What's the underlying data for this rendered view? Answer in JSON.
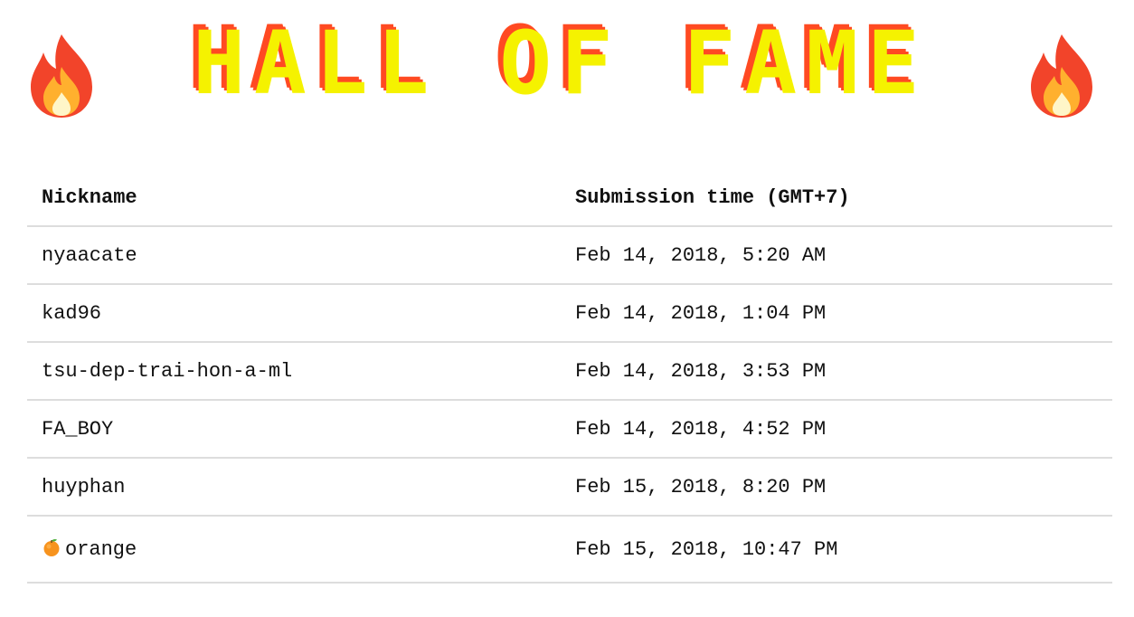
{
  "header": {
    "title": "HALL OF FAME",
    "left_icon": "fire-icon",
    "right_icon": "fire-icon"
  },
  "table": {
    "columns": [
      "Nickname",
      "Submission time (GMT+7)"
    ],
    "rows": [
      {
        "nickname": "nyaacate",
        "time": "Feb 14, 2018, 5:20 AM"
      },
      {
        "nickname": "kad96",
        "time": "Feb 14, 2018, 1:04 PM"
      },
      {
        "nickname": "tsu-dep-trai-hon-a-ml",
        "time": "Feb 14, 2018, 3:53 PM"
      },
      {
        "nickname": "FA_BOY",
        "time": "Feb 14, 2018, 4:52 PM"
      },
      {
        "nickname": "huyphan",
        "time": "Feb 15, 2018, 8:20 PM"
      },
      {
        "nickname": "orange",
        "nickname_icon": "orange-fruit-icon",
        "time": "Feb 15, 2018, 10:47 PM"
      }
    ]
  },
  "colors": {
    "title_fill": "#f5f200",
    "title_shadow": "#ff4a22",
    "fire_outer": "#f2442a",
    "fire_inner": "#ffb02e",
    "divider": "#dddddd"
  }
}
